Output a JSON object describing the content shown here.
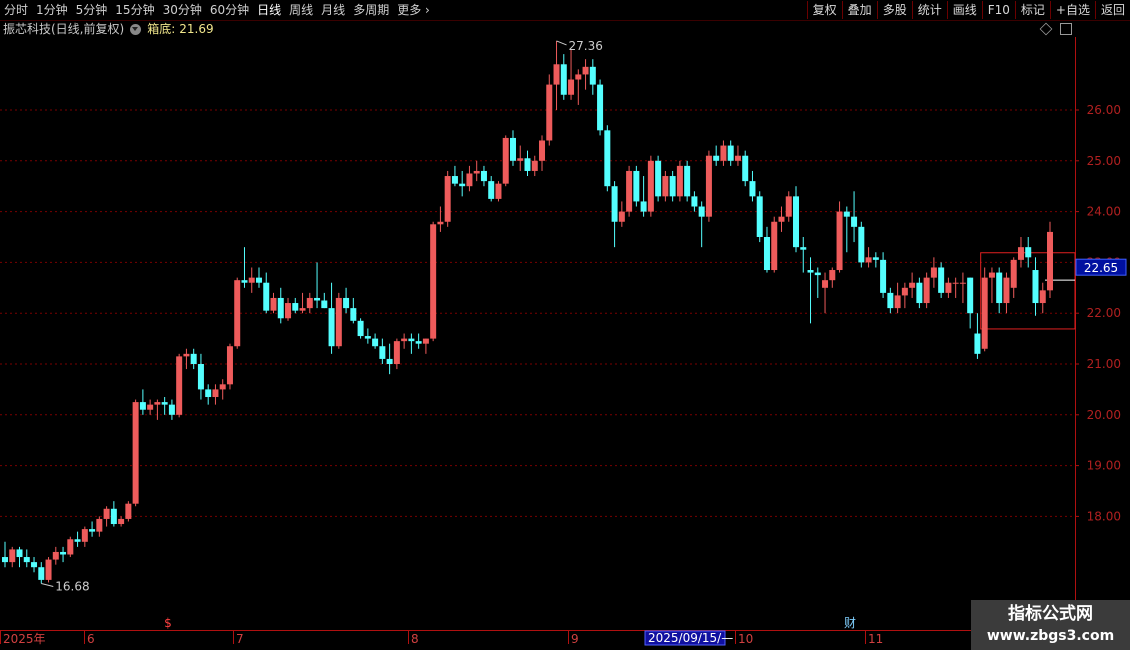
{
  "toolbar": {
    "periods": [
      "分时",
      "1分钟",
      "5分钟",
      "15分钟",
      "30分钟",
      "60分钟",
      "日线",
      "周线",
      "月线",
      "多周期",
      "更多"
    ],
    "active_period": "日线",
    "more_chevron": "chevron-right-icon",
    "buttons": [
      "复权",
      "叠加",
      "多股",
      "统计",
      "画线",
      "F10",
      "标记",
      "+自选",
      "返回"
    ]
  },
  "title": {
    "stock": "振芯科技(日线,前复权)",
    "indicator_name": "箱底:",
    "indicator_value": "21.69"
  },
  "price_axis": {
    "ticks": [
      "26.00",
      "25.00",
      "24.00",
      "23.00",
      "22.00",
      "21.00",
      "20.00",
      "19.00",
      "18.00"
    ],
    "current_price_badge": "22.65"
  },
  "annotations": {
    "high_label": "27.36",
    "low_label": "16.68"
  },
  "markers": {
    "dividend_marker": "$",
    "finance_marker": "财"
  },
  "time_axis": {
    "labels": [
      "2025年",
      "6",
      "7",
      "8",
      "9",
      "10",
      "11"
    ],
    "highlight_date": "2025/09/15/—"
  },
  "watermark": {
    "line1": "指标公式网",
    "line2": "www.zbgs3.com"
  },
  "colors": {
    "up": "#ee5b5b",
    "down": "#54ffff",
    "axis": "#b01010",
    "grid": "#7a0000",
    "badge_bg": "#0010a0",
    "box": "#e02020"
  },
  "chart_data": {
    "type": "candlestick",
    "price_range": [
      16.2,
      27.8
    ],
    "box_bottom": 21.69,
    "box_top": 23.19,
    "current_price": 22.65,
    "high": 27.36,
    "low": 16.68,
    "ohlc": [
      [
        17.2,
        17.5,
        17.0,
        17.1
      ],
      [
        17.1,
        17.4,
        17.0,
        17.35
      ],
      [
        17.35,
        17.4,
        17.0,
        17.2
      ],
      [
        17.2,
        17.35,
        17.0,
        17.1
      ],
      [
        17.1,
        17.2,
        16.9,
        17.0
      ],
      [
        17.0,
        17.1,
        16.68,
        16.75
      ],
      [
        16.75,
        17.2,
        16.7,
        17.15
      ],
      [
        17.15,
        17.4,
        17.05,
        17.3
      ],
      [
        17.3,
        17.4,
        17.1,
        17.25
      ],
      [
        17.25,
        17.6,
        17.2,
        17.55
      ],
      [
        17.55,
        17.7,
        17.4,
        17.5
      ],
      [
        17.5,
        17.8,
        17.4,
        17.75
      ],
      [
        17.75,
        17.9,
        17.6,
        17.7
      ],
      [
        17.7,
        18.0,
        17.6,
        17.95
      ],
      [
        17.95,
        18.2,
        17.8,
        18.15
      ],
      [
        18.15,
        18.3,
        17.8,
        17.85
      ],
      [
        17.85,
        18.0,
        17.8,
        17.95
      ],
      [
        17.95,
        18.3,
        17.9,
        18.25
      ],
      [
        18.25,
        20.3,
        18.2,
        20.25
      ],
      [
        20.25,
        20.5,
        20.0,
        20.1
      ],
      [
        20.1,
        20.3,
        20.0,
        20.2
      ],
      [
        20.2,
        20.3,
        19.9,
        20.25
      ],
      [
        20.25,
        20.35,
        20.0,
        20.2
      ],
      [
        20.2,
        20.3,
        19.9,
        20.0
      ],
      [
        20.0,
        21.2,
        19.95,
        21.15
      ],
      [
        21.15,
        21.3,
        20.9,
        21.2
      ],
      [
        21.2,
        21.3,
        20.9,
        21.0
      ],
      [
        21.0,
        21.2,
        20.3,
        20.5
      ],
      [
        20.5,
        20.6,
        20.2,
        20.35
      ],
      [
        20.35,
        20.6,
        20.2,
        20.5
      ],
      [
        20.5,
        20.7,
        20.3,
        20.6
      ],
      [
        20.6,
        21.4,
        20.5,
        21.35
      ],
      [
        21.35,
        22.7,
        21.3,
        22.65
      ],
      [
        22.65,
        23.3,
        22.5,
        22.6
      ],
      [
        22.6,
        22.9,
        22.4,
        22.7
      ],
      [
        22.7,
        22.9,
        22.5,
        22.6
      ],
      [
        22.6,
        22.8,
        22.0,
        22.05
      ],
      [
        22.05,
        22.4,
        22.0,
        22.3
      ],
      [
        22.3,
        22.5,
        21.8,
        21.9
      ],
      [
        21.9,
        22.3,
        21.85,
        22.2
      ],
      [
        22.2,
        22.3,
        22.0,
        22.05
      ],
      [
        22.05,
        22.4,
        22.0,
        22.1
      ],
      [
        22.1,
        22.4,
        22.0,
        22.3
      ],
      [
        22.3,
        23.0,
        22.1,
        22.25
      ],
      [
        22.25,
        22.4,
        22.1,
        22.1
      ],
      [
        22.1,
        22.6,
        21.2,
        21.35
      ],
      [
        21.35,
        22.4,
        21.3,
        22.3
      ],
      [
        22.3,
        22.5,
        22.0,
        22.1
      ],
      [
        22.1,
        22.3,
        21.8,
        21.85
      ],
      [
        21.85,
        21.9,
        21.5,
        21.55
      ],
      [
        21.55,
        21.7,
        21.4,
        21.5
      ],
      [
        21.5,
        21.6,
        21.3,
        21.35
      ],
      [
        21.35,
        21.5,
        21.0,
        21.1
      ],
      [
        21.1,
        21.4,
        20.8,
        21.0
      ],
      [
        21.0,
        21.5,
        20.9,
        21.45
      ],
      [
        21.45,
        21.6,
        21.3,
        21.5
      ],
      [
        21.5,
        21.6,
        21.2,
        21.45
      ],
      [
        21.45,
        21.6,
        21.3,
        21.4
      ],
      [
        21.4,
        21.5,
        21.2,
        21.5
      ],
      [
        21.5,
        23.8,
        21.45,
        23.75
      ],
      [
        23.75,
        24.1,
        23.6,
        23.8
      ],
      [
        23.8,
        24.8,
        23.7,
        24.7
      ],
      [
        24.7,
        24.9,
        24.5,
        24.55
      ],
      [
        24.55,
        24.8,
        24.3,
        24.5
      ],
      [
        24.5,
        24.9,
        24.4,
        24.75
      ],
      [
        24.75,
        25.0,
        24.6,
        24.8
      ],
      [
        24.8,
        24.9,
        24.5,
        24.6
      ],
      [
        24.6,
        24.7,
        24.2,
        24.25
      ],
      [
        24.25,
        24.6,
        24.2,
        24.55
      ],
      [
        24.55,
        25.5,
        24.5,
        25.45
      ],
      [
        25.45,
        25.6,
        24.9,
        25.0
      ],
      [
        25.0,
        25.3,
        24.8,
        25.05
      ],
      [
        25.05,
        25.2,
        24.7,
        24.8
      ],
      [
        24.8,
        25.1,
        24.7,
        25.0
      ],
      [
        25.0,
        25.5,
        24.8,
        25.4
      ],
      [
        25.4,
        26.7,
        25.3,
        26.5
      ],
      [
        26.5,
        27.36,
        26.0,
        26.9
      ],
      [
        26.9,
        27.1,
        26.2,
        26.3
      ],
      [
        26.3,
        27.2,
        26.2,
        26.6
      ],
      [
        26.6,
        26.8,
        26.1,
        26.7
      ],
      [
        26.7,
        27.0,
        26.4,
        26.85
      ],
      [
        26.85,
        27.0,
        26.3,
        26.5
      ],
      [
        26.5,
        26.6,
        25.5,
        25.6
      ],
      [
        25.6,
        25.7,
        24.4,
        24.5
      ],
      [
        24.5,
        24.6,
        23.3,
        23.8
      ],
      [
        23.8,
        24.2,
        23.7,
        24.0
      ],
      [
        24.0,
        24.9,
        23.9,
        24.8
      ],
      [
        24.8,
        24.9,
        24.1,
        24.2
      ],
      [
        24.2,
        24.7,
        23.9,
        24.0
      ],
      [
        24.0,
        25.1,
        23.9,
        25.0
      ],
      [
        25.0,
        25.1,
        24.2,
        24.3
      ],
      [
        24.3,
        24.8,
        24.2,
        24.7
      ],
      [
        24.7,
        24.8,
        24.2,
        24.3
      ],
      [
        24.3,
        25.0,
        24.2,
        24.9
      ],
      [
        24.9,
        25.0,
        24.2,
        24.3
      ],
      [
        24.3,
        24.4,
        24.0,
        24.1
      ],
      [
        24.1,
        24.2,
        23.3,
        23.9
      ],
      [
        23.9,
        25.2,
        23.8,
        25.1
      ],
      [
        25.1,
        25.3,
        24.9,
        25.0
      ],
      [
        25.0,
        25.4,
        24.9,
        25.3
      ],
      [
        25.3,
        25.4,
        24.9,
        25.0
      ],
      [
        25.0,
        25.3,
        24.9,
        25.1
      ],
      [
        25.1,
        25.2,
        24.5,
        24.6
      ],
      [
        24.6,
        24.8,
        24.2,
        24.3
      ],
      [
        24.3,
        24.4,
        23.4,
        23.5
      ],
      [
        23.5,
        23.7,
        22.8,
        22.85
      ],
      [
        22.85,
        23.9,
        22.8,
        23.8
      ],
      [
        23.8,
        24.1,
        23.6,
        23.9
      ],
      [
        23.9,
        24.4,
        23.8,
        24.3
      ],
      [
        24.3,
        24.5,
        23.2,
        23.3
      ],
      [
        23.3,
        23.5,
        22.8,
        23.25
      ],
      [
        22.85,
        23.1,
        21.8,
        22.8
      ],
      [
        22.8,
        22.9,
        22.3,
        22.75
      ],
      [
        22.5,
        22.8,
        22.0,
        22.65
      ],
      [
        22.65,
        22.9,
        22.5,
        22.85
      ],
      [
        22.85,
        24.2,
        22.8,
        24.0
      ],
      [
        24.0,
        24.1,
        23.2,
        23.9
      ],
      [
        23.9,
        24.4,
        23.4,
        23.7
      ],
      [
        23.7,
        23.8,
        22.9,
        23.0
      ],
      [
        23.0,
        23.3,
        22.9,
        23.1
      ],
      [
        23.1,
        23.2,
        22.9,
        23.05
      ],
      [
        23.05,
        23.2,
        22.3,
        22.4
      ],
      [
        22.4,
        22.5,
        22.0,
        22.1
      ],
      [
        22.1,
        22.6,
        22.0,
        22.35
      ],
      [
        22.35,
        22.6,
        22.1,
        22.5
      ],
      [
        22.5,
        22.8,
        22.3,
        22.6
      ],
      [
        22.6,
        22.7,
        22.1,
        22.2
      ],
      [
        22.2,
        22.8,
        22.1,
        22.7
      ],
      [
        22.7,
        23.1,
        22.5,
        22.9
      ],
      [
        22.9,
        23.0,
        22.3,
        22.4
      ],
      [
        22.4,
        22.7,
        22.3,
        22.6
      ],
      [
        22.6,
        22.7,
        22.3,
        22.6
      ],
      [
        22.6,
        22.8,
        22.2,
        22.6
      ],
      [
        22.7,
        22.7,
        21.7,
        22.0
      ],
      [
        21.6,
        22.0,
        21.1,
        21.2
      ],
      [
        21.3,
        22.9,
        21.25,
        22.7
      ],
      [
        22.7,
        22.9,
        22.2,
        22.8
      ],
      [
        22.8,
        22.9,
        22.0,
        22.2
      ],
      [
        22.2,
        22.8,
        22.0,
        22.7
      ],
      [
        22.5,
        23.1,
        22.3,
        23.05
      ],
      [
        23.05,
        23.5,
        22.9,
        23.3
      ],
      [
        23.3,
        23.5,
        22.9,
        23.1
      ],
      [
        22.85,
        23.1,
        21.95,
        22.2
      ],
      [
        22.2,
        22.6,
        22.0,
        22.45
      ],
      [
        22.45,
        23.8,
        22.3,
        23.6
      ]
    ]
  }
}
